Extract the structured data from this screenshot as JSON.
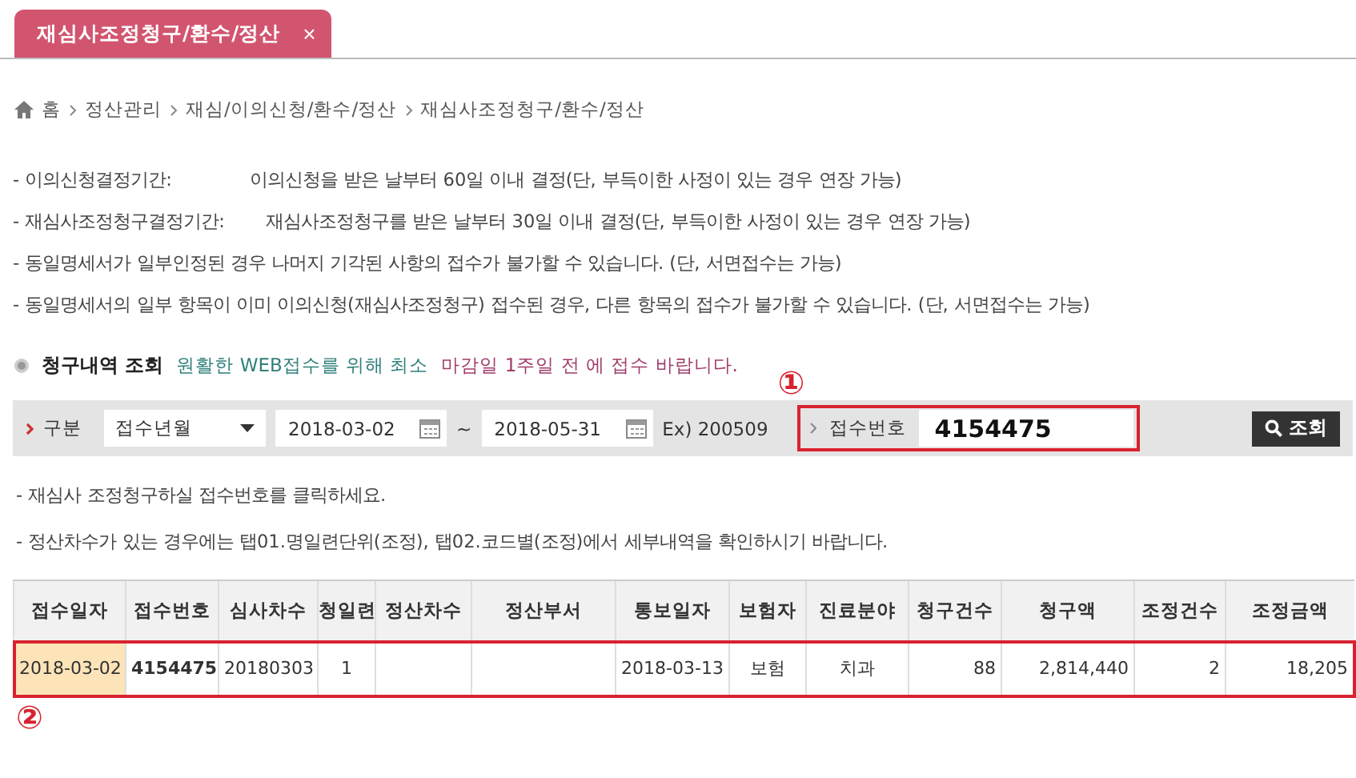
{
  "tabs": [
    {
      "label": "재심사조정청구/환수/정산",
      "close": "×",
      "selected": true
    }
  ],
  "breadcrumb": [
    "홈",
    "정산관리",
    "재심/이의신청/환수/정산",
    "재심사조정청구/환수/정산"
  ],
  "notes": [
    {
      "label": "- 이의신청결정기간:",
      "text": "이의신청을 받은 날부터 60일 이내 결정(단, 부득이한 사정이 있는 경우 연장 가능)"
    },
    {
      "label": "- 재심사조정청구결정기간:",
      "text": "재심사조정청구를 받은 날부터 30일 이내 결정(단, 부득이한 사정이 있는 경우 연장 가능)"
    },
    {
      "text": "- 동일명세서가 일부인정된 경우 나머지 기각된 사항의 접수가 불가할 수 있습니다. (단, 서면접수는 가능)"
    },
    {
      "text": "- 동일명세서의 일부 항목이 이미 이의신청(재심사조정청구) 접수된 경우, 다른 항목의 접수가 불가할 수 있습니다. (단, 서면접수는 가능)"
    }
  ],
  "section": {
    "title": "청구내역 조회",
    "hint": "원활한 WEB접수를 위해 최소",
    "deadline": "마감일 1주일 전 에 접수 바랍니다."
  },
  "search": {
    "type_label": "구분",
    "type_value": "접수년월",
    "date_from": "2018-03-02",
    "tilde": "~",
    "date_to": "2018-05-31",
    "example": "Ex) 200509",
    "number_label": "접수번호",
    "number_value": "4154475",
    "number_marker": "①",
    "button": "조회"
  },
  "help": [
    "- 재심사 조정청구하실 접수번호를 클릭하세요.",
    "- 정산차수가 있는 경우에는 탭01.명일련단위(조정), 탭02.코드별(조정)에서 세부내역을 확인하시기 바랍니다."
  ],
  "table": {
    "columns": [
      "접수일자",
      "접수번호",
      "심사차수",
      "청일련",
      "정산차수",
      "정산부서",
      "통보일자",
      "보험자",
      "진료분야",
      "청구건수",
      "청구액",
      "조정건수",
      "조정금액"
    ],
    "rows": [
      {
        "selected": true,
        "marker": "②",
        "cells": [
          "2018-03-02",
          "4154475",
          "20180303",
          "1",
          "",
          "",
          "2018-03-13",
          "보험",
          "치과",
          "88",
          "2,814,440",
          "2",
          "18,205"
        ]
      }
    ]
  }
}
